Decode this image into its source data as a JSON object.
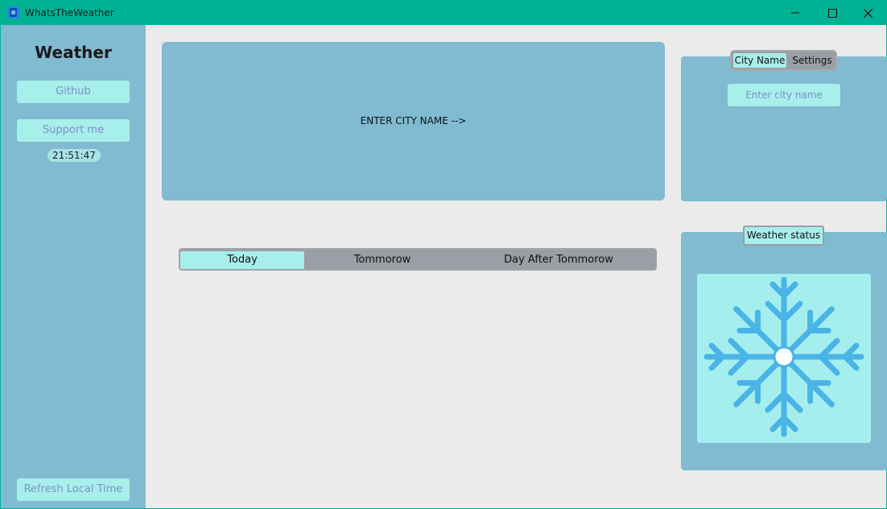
{
  "window": {
    "title": "WhatsTheWeather"
  },
  "sidebar": {
    "title": "Weather",
    "github_label": "Github",
    "support_label": "Support me",
    "local_time": "21:51:47",
    "refresh_label": "Refresh Local Time"
  },
  "info": {
    "message": "ENTER CITY NAME  -->"
  },
  "day_tabs": [
    {
      "label": "Today",
      "active": true
    },
    {
      "label": "Tommorow",
      "active": false
    },
    {
      "label": "Day After Tommorow",
      "active": false
    }
  ],
  "city_panel": {
    "tabs": [
      {
        "label": "City Name",
        "active": true
      },
      {
        "label": "Settings",
        "active": false
      }
    ],
    "input_placeholder": "Enter city name",
    "input_value": ""
  },
  "status_panel": {
    "label": "Weather status",
    "icon": "snowflake-icon"
  },
  "colors": {
    "titlebar": "#00b294",
    "panel": "#80bbd2",
    "button": "#a7efea",
    "button_text": "#7d8fc8",
    "snowflake": "#4ab4e6"
  }
}
